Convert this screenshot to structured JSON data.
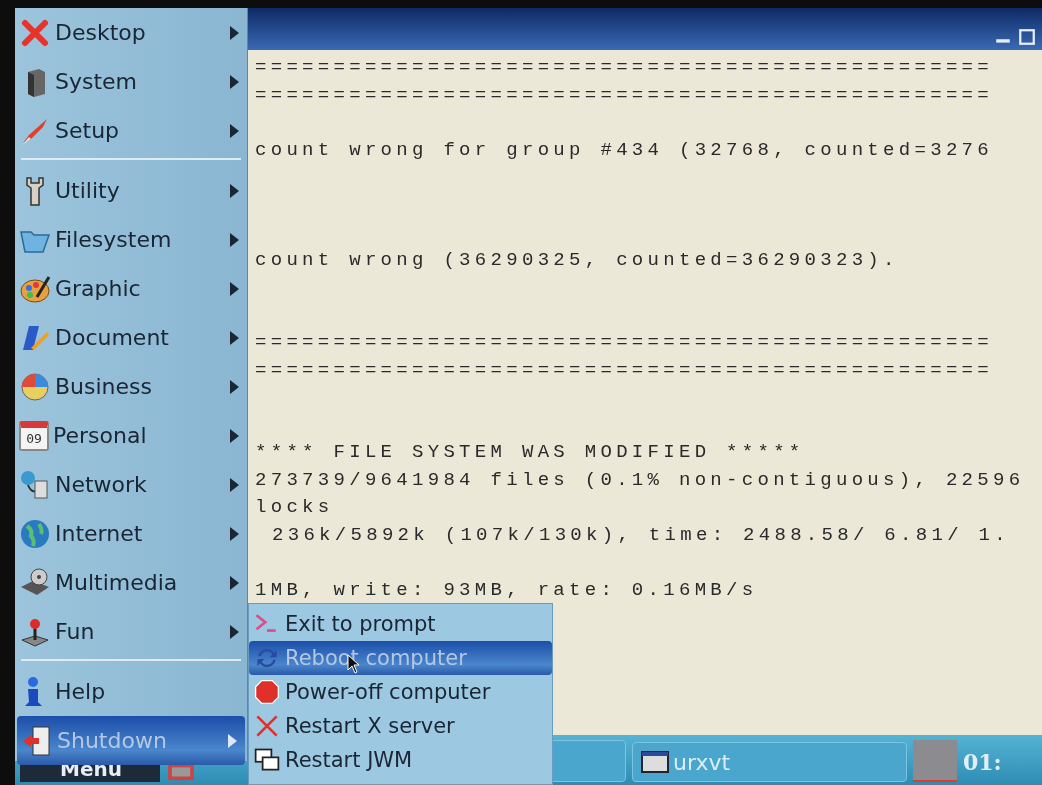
{
  "terminal": {
    "lines": [
      {
        "kind": "text",
        "text": "==============================================="
      },
      {
        "kind": "text",
        "text": "==============================================="
      },
      {
        "kind": "blank"
      },
      {
        "kind": "text",
        "text": "count wrong for group #434 (32768, counted=3276"
      },
      {
        "kind": "blank"
      },
      {
        "kind": "blank"
      },
      {
        "kind": "blank"
      },
      {
        "kind": "text",
        "text": "count wrong (36290325, counted=36290323)."
      },
      {
        "kind": "blank"
      },
      {
        "kind": "blank"
      },
      {
        "kind": "text",
        "text": "==============================================="
      },
      {
        "kind": "text",
        "text": "==============================================="
      },
      {
        "kind": "blank"
      },
      {
        "kind": "blank"
      },
      {
        "kind": "text",
        "text": "**** FILE SYSTEM WAS MODIFIED *****"
      },
      {
        "kind": "text",
        "text": "273739/9641984 files (0.1% non-contiguous), 22596"
      },
      {
        "kind": "text",
        "text": "locks"
      },
      {
        "kind": "indented",
        "text": "236k/5892k (107k/130k), time: 2488.58/ 6.81/ 1."
      },
      {
        "kind": "blank"
      },
      {
        "kind": "text",
        "text": "1MB, write: 93MB, rate: 0.16MB/s"
      }
    ]
  },
  "main_menu": {
    "items": [
      {
        "kind": "item",
        "label": "Desktop",
        "selected": false
      },
      {
        "kind": "item",
        "label": "System",
        "selected": false
      },
      {
        "kind": "item",
        "label": "Setup",
        "selected": false
      },
      {
        "kind": "separator"
      },
      {
        "kind": "item",
        "label": "Utility",
        "selected": false
      },
      {
        "kind": "item",
        "label": "Filesystem",
        "selected": false
      },
      {
        "kind": "item",
        "label": "Graphic",
        "selected": false
      },
      {
        "kind": "item",
        "label": "Document",
        "selected": false
      },
      {
        "kind": "item",
        "label": "Business",
        "selected": false
      },
      {
        "kind": "item",
        "label": "Personal",
        "selected": false,
        "calendar_date": "09"
      },
      {
        "kind": "item",
        "label": "Network",
        "selected": false
      },
      {
        "kind": "item",
        "label": "Internet",
        "selected": false
      },
      {
        "kind": "item",
        "label": "Multimedia",
        "selected": false
      },
      {
        "kind": "item",
        "label": "Fun",
        "selected": false
      },
      {
        "kind": "separator"
      },
      {
        "kind": "item",
        "label": "Help",
        "selected": false,
        "leaf": true
      },
      {
        "kind": "item",
        "label": "Shutdown",
        "selected": true
      }
    ]
  },
  "shutdown_menu": {
    "items": [
      {
        "label": "Exit to prompt",
        "selected": false
      },
      {
        "label": "Reboot computer",
        "selected": true
      },
      {
        "label": "Power-off computer",
        "selected": false
      },
      {
        "label": "Restart X server",
        "selected": false
      },
      {
        "label": "Restart JWM",
        "selected": false
      }
    ]
  },
  "taskbar": {
    "menu_button": "Menu",
    "task": "urxvt",
    "clock": "01:"
  }
}
